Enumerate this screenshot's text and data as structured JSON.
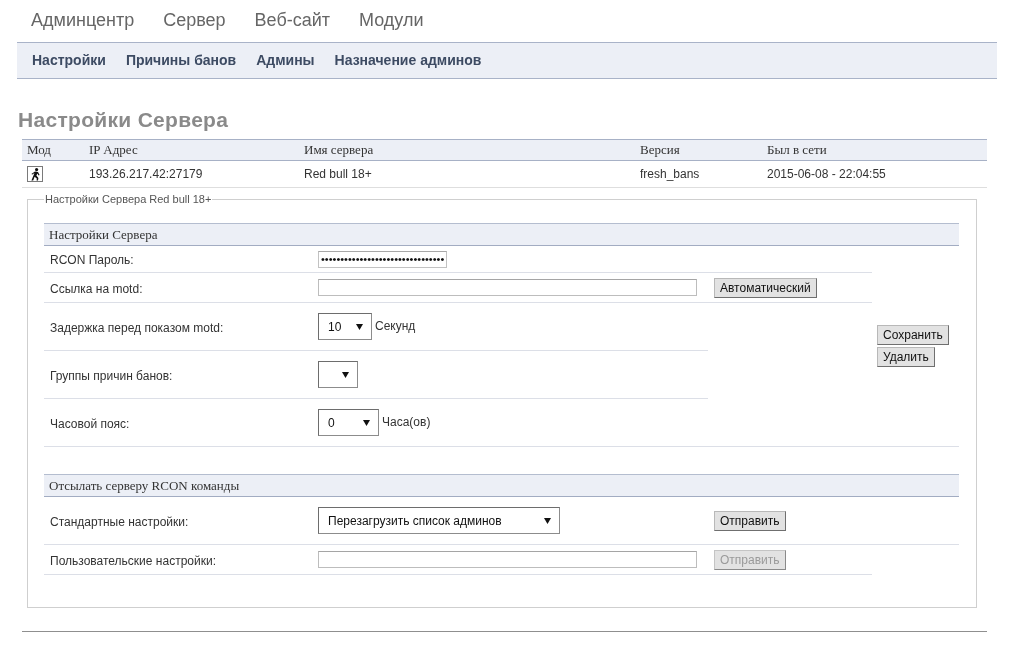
{
  "top_menu": [
    "Админцентр",
    "Сервер",
    "Веб-сайт",
    "Модули"
  ],
  "sub_menu": [
    "Настройки",
    "Причины банов",
    "Админы",
    "Назначение админов"
  ],
  "page_title": "Настройки Сервера",
  "server_table": {
    "columns": [
      "Мод",
      "IP Адрес",
      "Имя сервера",
      "Версия",
      "Был в сети"
    ],
    "rows": [
      {
        "ip": "193.26.217.42:27179",
        "server_name": "Red bull 18+",
        "version": "fresh_bans",
        "last_seen": "2015-06-08 - 22:04:55"
      }
    ]
  },
  "settings_panel": {
    "legend": "Настройки Сервера Red bull 18+",
    "server_settings": {
      "title": "Настройки Сервера",
      "fields": [
        {
          "kind": "password",
          "label": "RCON Пароль:",
          "value": "••••••••••••••••••••••••••••••••"
        },
        {
          "kind": "text",
          "label": "Ссылка на motd:",
          "button": {
            "label": "Автоматический",
            "disabled": false
          }
        },
        {
          "kind": "select",
          "label": "Задержка перед показом motd:",
          "value": "10",
          "unit": "Секунд"
        },
        {
          "kind": "select",
          "label": "Группы причин банов:"
        },
        {
          "kind": "select",
          "label": "Часовой пояс:",
          "value": "0",
          "unit": "Часа(ов)"
        }
      ],
      "actions": [
        {
          "label": "Сохранить",
          "disabled": false
        },
        {
          "label": "Удалить",
          "disabled": false
        }
      ]
    },
    "rcon_commands": {
      "title": "Отсылать серверу RCON команды",
      "fields": [
        {
          "kind": "select",
          "label": "Стандартные настройки:",
          "value": "Перезагрузить список админов",
          "button": {
            "label": "Отправить",
            "disabled": false
          }
        },
        {
          "kind": "text",
          "label": "Пользовательские настройки:",
          "button": {
            "label": "Отправить",
            "disabled": true
          }
        }
      ]
    }
  }
}
